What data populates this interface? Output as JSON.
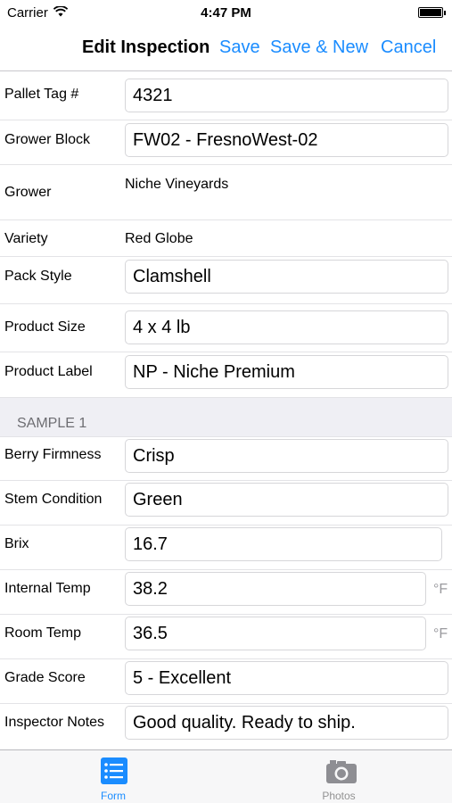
{
  "status_bar": {
    "carrier": "Carrier",
    "time": "4:47 PM"
  },
  "nav_bar": {
    "title": "Edit Inspection",
    "save_label": "Save",
    "save_new_label": "Save & New",
    "cancel_label": "Cancel"
  },
  "form": {
    "fields": [
      {
        "label": "Pallet Tag #",
        "value": "4321"
      },
      {
        "label": "Grower Block",
        "value": "FW02 - FresnoWest-02"
      },
      {
        "label": "Grower",
        "value": "Niche Vineyards"
      },
      {
        "label": "Variety",
        "value": "Red Globe"
      },
      {
        "label": "Pack Style",
        "value": "Clamshell"
      },
      {
        "label": "Product Size",
        "value": "4 x 4 lb"
      },
      {
        "label": "Product Label",
        "value": "NP - Niche Premium"
      }
    ],
    "sample_header": "SAMPLE 1",
    "sample_fields": [
      {
        "label": "Berry Firmness",
        "value": "Crisp"
      },
      {
        "label": "Stem Condition",
        "value": "Green"
      },
      {
        "label": "Brix",
        "value": "16.7"
      },
      {
        "label": "Internal Temp",
        "value": "38.2",
        "unit": "°F"
      },
      {
        "label": "Room Temp",
        "value": "36.5",
        "unit": "°F"
      },
      {
        "label": "Grade Score",
        "value": "5 - Excellent"
      },
      {
        "label": "Inspector Notes",
        "value": "Good quality. Ready to ship."
      }
    ]
  },
  "tab_bar": {
    "tabs": [
      {
        "label": "Form",
        "icon": "list-icon",
        "active": true
      },
      {
        "label": "Photos",
        "icon": "camera-icon",
        "active": false
      }
    ],
    "active_color": "#1a8cff",
    "inactive_color": "#929292"
  }
}
